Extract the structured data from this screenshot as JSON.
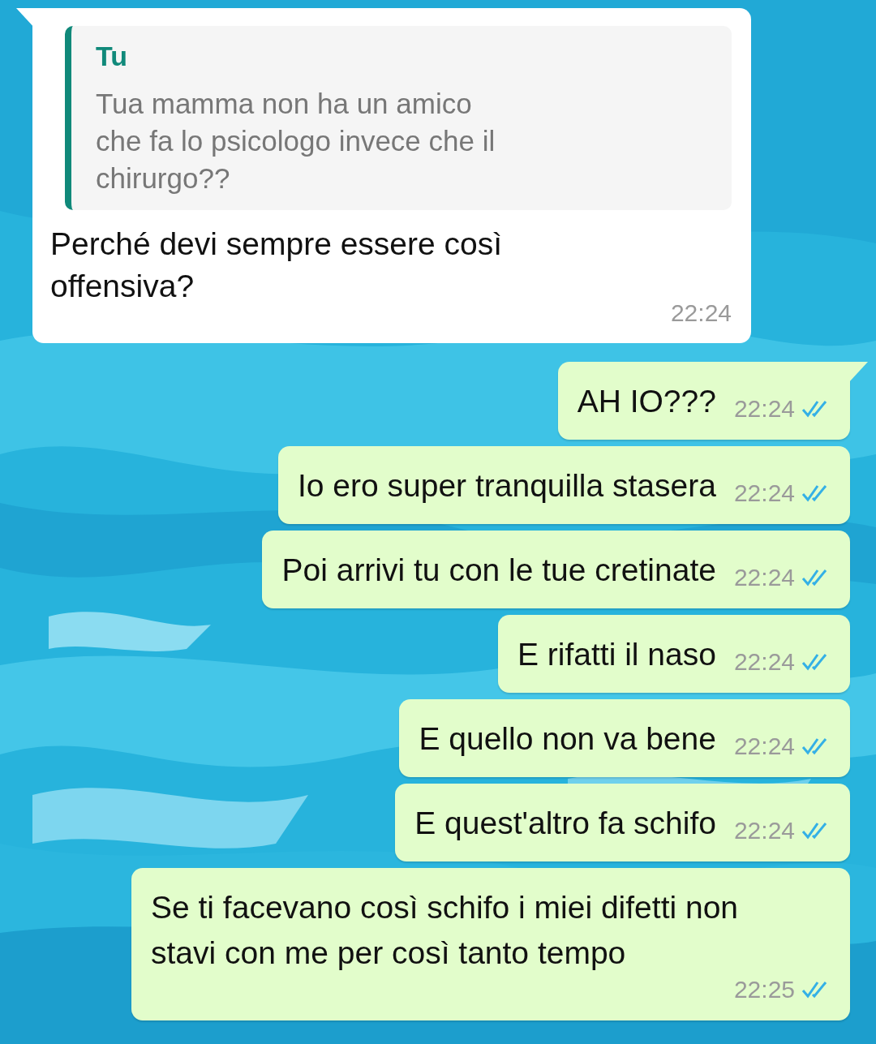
{
  "messages": [
    {
      "kind": "received",
      "tail": true,
      "quote": {
        "author": "Tu",
        "text": "Tua mamma non ha un amico\nche fa lo psicologo invece che il\nchirurgo??"
      },
      "text": "Perché devi sempre essere così offensiva?",
      "time": "22:24"
    },
    {
      "kind": "sent",
      "tail": true,
      "text": "AH IO???",
      "time": "22:24",
      "read": true
    },
    {
      "kind": "sent",
      "tail": false,
      "text": "Io ero super tranquilla stasera",
      "time": "22:24",
      "read": true
    },
    {
      "kind": "sent",
      "tail": false,
      "text": "Poi arrivi tu con le tue cretinate",
      "time": "22:24",
      "read": true
    },
    {
      "kind": "sent",
      "tail": false,
      "text": "E rifatti il naso",
      "time": "22:24",
      "read": true
    },
    {
      "kind": "sent",
      "tail": false,
      "text": "E quello non va bene",
      "time": "22:24",
      "read": true
    },
    {
      "kind": "sent",
      "tail": false,
      "text": "E quest'altro fa schifo",
      "time": "22:24",
      "read": true
    },
    {
      "kind": "sent",
      "tail": false,
      "text": "Se ti facevano così schifo i miei difetti non stavi con me per così tanto tempo",
      "time": "22:25",
      "read": true
    }
  ]
}
